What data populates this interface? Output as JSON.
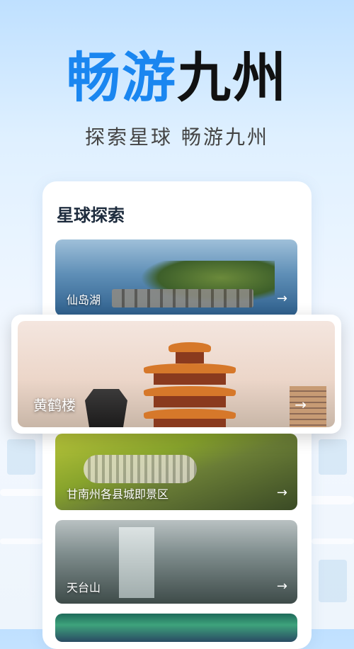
{
  "hero": {
    "title_part1": "畅游",
    "title_part2": "九州",
    "subtitle": "探索星球  畅游九州"
  },
  "section": {
    "title": "星球探索"
  },
  "spots": [
    {
      "label": "仙岛湖",
      "arrow": "→"
    },
    {
      "label": "黄鹤楼",
      "arrow": "→"
    },
    {
      "label": "甘南州各县城即景区",
      "arrow": "→"
    },
    {
      "label": "天台山",
      "arrow": "→"
    },
    {
      "label": "",
      "arrow": ""
    }
  ],
  "colors": {
    "accent": "#1a86f0",
    "title_dark": "#111111",
    "card_bg": "#ffffff"
  },
  "icons": {
    "arrow": "right-arrow-icon"
  }
}
